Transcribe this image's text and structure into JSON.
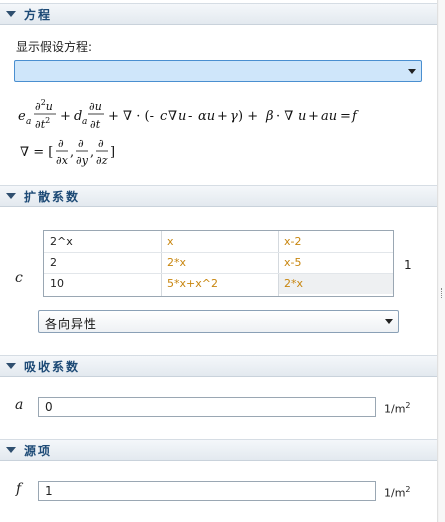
{
  "sections": {
    "equation": {
      "title": "方程"
    },
    "diffusion": {
      "title": "扩散系数"
    },
    "absorption": {
      "title": "吸收系数"
    },
    "source": {
      "title": "源项"
    }
  },
  "equation": {
    "show_label": "显示假设方程:",
    "dropdown_value": ""
  },
  "diffusion": {
    "symbol": "c",
    "matrix": [
      [
        "2^x",
        "x",
        "x-2"
      ],
      [
        "2",
        "2*x",
        "x-5"
      ],
      [
        "10",
        "5*x+x^2",
        "2*x"
      ]
    ],
    "unit": "1",
    "mode": "各向异性"
  },
  "absorption": {
    "symbol": "a",
    "value": "0",
    "unit": "1/m",
    "unit_exp": "2"
  },
  "source": {
    "symbol": "f",
    "value": "1",
    "unit": "1/m",
    "unit_exp": "2"
  },
  "colors": {
    "header_text": "#1d4a76",
    "expression_orange": "#c8860f",
    "selected_dropdown": "#cfe6fa"
  }
}
